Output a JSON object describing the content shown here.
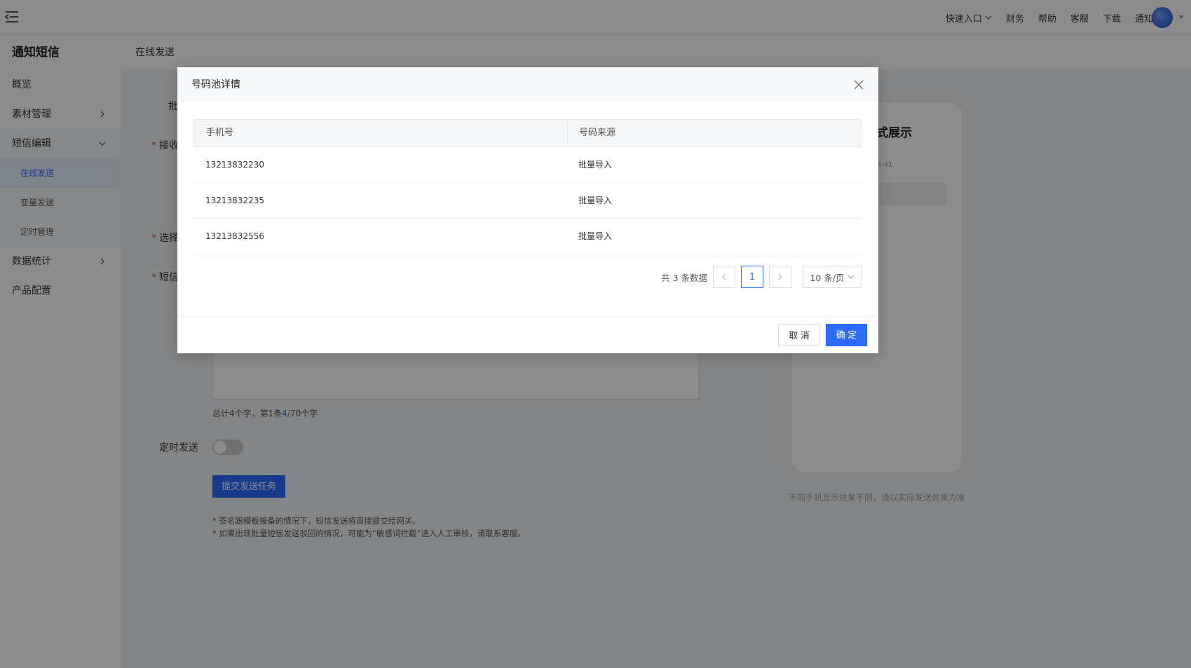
{
  "topbar": {
    "nav": [
      "快速入口",
      "财务",
      "帮助",
      "客服",
      "下载",
      "通知"
    ]
  },
  "sidebar": {
    "title": "通知短信",
    "items": [
      {
        "label": "概览"
      },
      {
        "label": "素材管理"
      },
      {
        "label": "短信编辑"
      },
      {
        "label": "在线发送"
      },
      {
        "label": "变量发送"
      },
      {
        "label": "定时管理"
      },
      {
        "label": "数据统计"
      },
      {
        "label": "产品配置"
      }
    ]
  },
  "page": {
    "breadcrumb": "在线发送",
    "labels": {
      "batch": "批",
      "receiver": "接收",
      "select": "选择",
      "sms": "短信",
      "schedule": "定时发送"
    },
    "counter": {
      "prefix": "总计4个字，第1条",
      "current": "4",
      "suffix": "/70个字"
    },
    "submit_label": "提交发送任务",
    "notes": [
      "* 签名跟模板报备的情况下，短信发送将直接提交给网关。",
      "* 如果出现批量短信发送驳回的情况，可能为“敏感词拦截”进入人工审核，请联系客服。"
    ],
    "preview": {
      "title": "式展示",
      "time": "5:41",
      "note": "不同手机显示效果不同，请以实际发送效果为准"
    }
  },
  "modal": {
    "title": "号码池详情",
    "columns": [
      "手机号",
      "号码来源"
    ],
    "rows": [
      {
        "phone": "13213832230",
        "source": "批量导入"
      },
      {
        "phone": "13213832235",
        "source": "批量导入"
      },
      {
        "phone": "13213832556",
        "source": "批量导入"
      }
    ],
    "pagination": {
      "total_text": "共 3 条数据",
      "current_page": "1",
      "page_size": "10 条/页"
    },
    "cancel_label": "取 消",
    "ok_label": "确 定"
  }
}
